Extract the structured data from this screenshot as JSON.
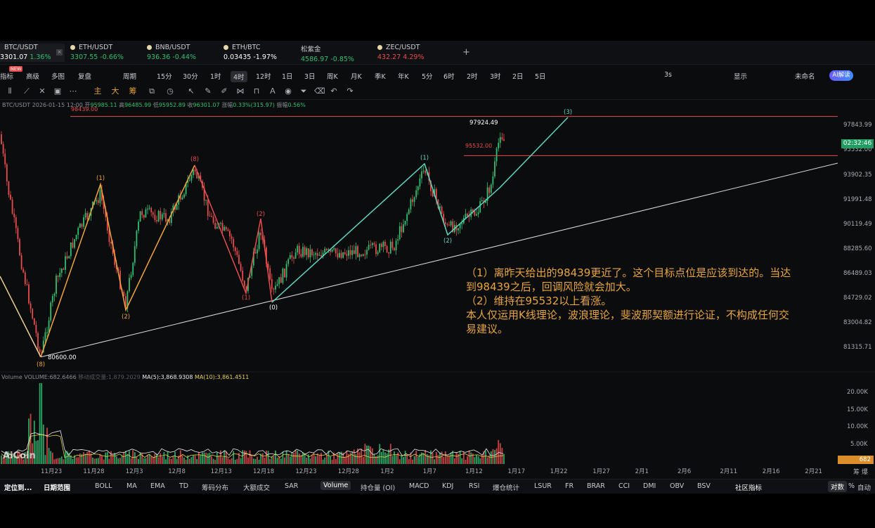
{
  "tickers": [
    {
      "name": "BTC/USDT",
      "price": "3301.07",
      "change": "1.36%",
      "dir": "up"
    },
    {
      "name": "ETH/USDT",
      "price": "3307.55",
      "change": "-0.66%",
      "dir": "up"
    },
    {
      "name": "BNB/USDT",
      "price": "936.36",
      "change": "-0.44%",
      "dir": "up"
    },
    {
      "name": "ETH/BTC",
      "price": "0.03435",
      "change": "-1.97%",
      "dir": "white"
    },
    {
      "name": "松紫金",
      "price": "4586.97",
      "change": "-0.85%",
      "dir": "up"
    },
    {
      "name": "ZEC/USDT",
      "price": "432.27",
      "change": "4.29%",
      "dir": "down"
    }
  ],
  "toolbar": {
    "items": [
      "指标",
      "高级",
      "多图",
      "复盘",
      "周期",
      "15分",
      "30分",
      "1时",
      "4时",
      "12时",
      "1日",
      "3日",
      "周K",
      "月K",
      "季K",
      "年K",
      "5分",
      "6时",
      "2时",
      "3时",
      "2日",
      "5日"
    ],
    "new_badge": "NEW",
    "right": [
      "3s",
      "显示",
      "未命名"
    ],
    "ai": "AI解读"
  },
  "drawbar": {
    "chars": [
      "主",
      "大",
      "筹"
    ]
  },
  "chart": {
    "info_symbol": "BTC/USDT",
    "info_time": "2026-01-15 12:00",
    "info_open": "95985.11",
    "info_high": "96485.99",
    "info_low": "95952.89",
    "info_close": "96301.07",
    "info_change": "0.33%(315.97)",
    "info_amp": "0.56%",
    "info_labels": {
      "open": "开",
      "high": "高",
      "low": "低",
      "close": "收",
      "change": "涨幅",
      "amp": "振幅"
    },
    "price_axis": [
      "97843.99",
      "95532.00",
      "93902.35",
      "91991.48",
      "90119.49",
      "88285.60",
      "86489.03",
      "84729.02",
      "83004.82",
      "81315.71"
    ],
    "current_price": "96301.07",
    "countdown": "02:32:46",
    "line_98439": "98439.00",
    "line_95532": "95532.00",
    "high_label": "97924.49",
    "low_label": "80600.00",
    "wave_labels": {
      "w8_top": "(8)",
      "w8_bot": "(8)",
      "w1": "(1)",
      "w2": "(2)",
      "w3": "(3)",
      "w0": "(0)"
    },
    "volume_title": "Volume  VOLUME:682.6466",
    "volume_sub": "移动成交量:1,879.2029",
    "ma5": "MA(5):3,868.9308",
    "ma10": "MA(10):3,861.4511",
    "volume_axis": [
      "20.00K",
      "15.00K",
      "10.00K",
      "5.00K"
    ],
    "volume_current": "682",
    "date_axis": [
      "11月23",
      "11月28",
      "12月3",
      "12月8",
      "12月13",
      "12月18",
      "12月23",
      "12月28",
      "1月2",
      "1月7",
      "1月12",
      "1月17",
      "1月22",
      "1月27",
      "2月1",
      "2月6",
      "2月11",
      "2月16",
      "2月21"
    ],
    "logo": "AiCoin"
  },
  "annotation": [
    "（1）离昨天给出的98439更近了。这个目标点位是应该到达的。当达",
    "到98439之后，回调风险就会加大。",
    "（2）维持在95532以上看涨。",
    "本人仅运用K线理论，波浪理论，斐波那契额进行论证，不构成任何交",
    "易建议。"
  ],
  "bottom": {
    "items": [
      "定位到...",
      "日期范围",
      "BOLL",
      "MA",
      "EMA",
      "TD",
      "筹码分布",
      "大额成交",
      "SAR",
      "Volume",
      "持仓量 (OI)",
      "MACD",
      "KDJ",
      "RSI",
      "爆仓统计",
      "LSUR",
      "FR",
      "BRAR",
      "CCI",
      "DMI",
      "OBV",
      "BSV",
      "社区指标"
    ],
    "right": [
      "对数",
      "%",
      "自动"
    ],
    "corner": [
      "筹",
      "爆"
    ]
  },
  "colors": {
    "up": "#2fbf71",
    "down": "#e84c4c",
    "accent": "#e8a53a",
    "wave_cyan": "#5fd6c4",
    "wave_orange": "#f0a43a",
    "wave_red": "#e84c4c"
  }
}
